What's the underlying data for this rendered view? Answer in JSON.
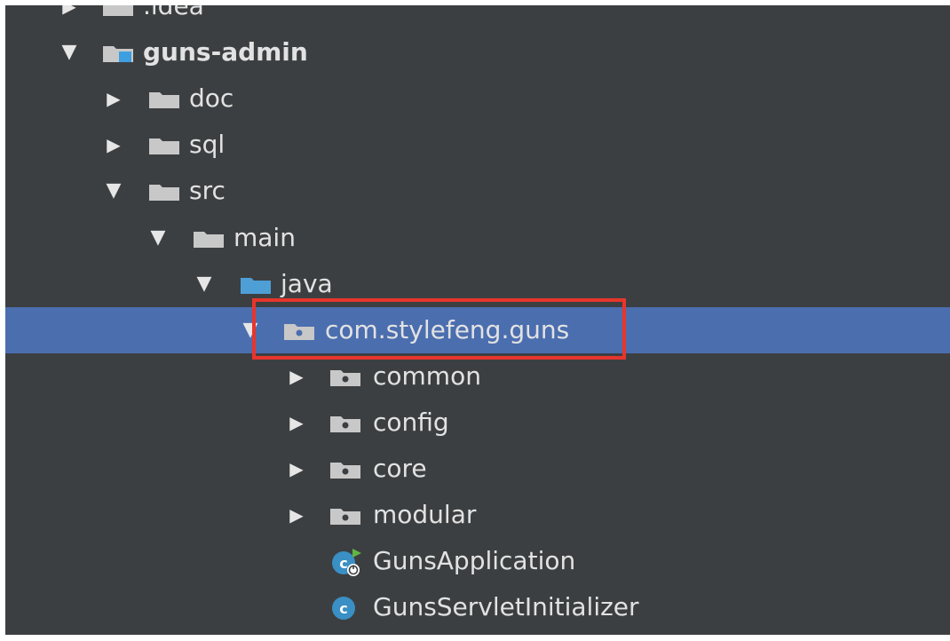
{
  "tree": {
    "rows": [
      {
        "label": ".idea",
        "expanded": false,
        "icon": "folder-icon"
      },
      {
        "label": "guns-admin",
        "expanded": true,
        "icon": "module-folder-icon"
      },
      {
        "label": "doc",
        "expanded": false,
        "icon": "folder-icon"
      },
      {
        "label": "sql",
        "expanded": false,
        "icon": "folder-icon"
      },
      {
        "label": "src",
        "expanded": true,
        "icon": "folder-icon"
      },
      {
        "label": "main",
        "expanded": true,
        "icon": "folder-icon"
      },
      {
        "label": "java",
        "expanded": true,
        "icon": "source-folder-icon"
      },
      {
        "label": "com.stylefeng.guns",
        "expanded": true,
        "icon": "package-icon",
        "selected": true
      },
      {
        "label": "common",
        "expanded": false,
        "icon": "package-icon"
      },
      {
        "label": "config",
        "expanded": false,
        "icon": "package-icon"
      },
      {
        "label": "core",
        "expanded": false,
        "icon": "package-icon"
      },
      {
        "label": "modular",
        "expanded": false,
        "icon": "package-icon"
      },
      {
        "label": "GunsApplication",
        "icon": "spring-boot-class-icon"
      },
      {
        "label": "GunsServletInitializer",
        "icon": "class-icon"
      }
    ]
  },
  "colors": {
    "background": "#3c3f41",
    "selection": "#4b6eaf",
    "highlight_border": "#e8352c",
    "text": "#e2e2e2"
  }
}
